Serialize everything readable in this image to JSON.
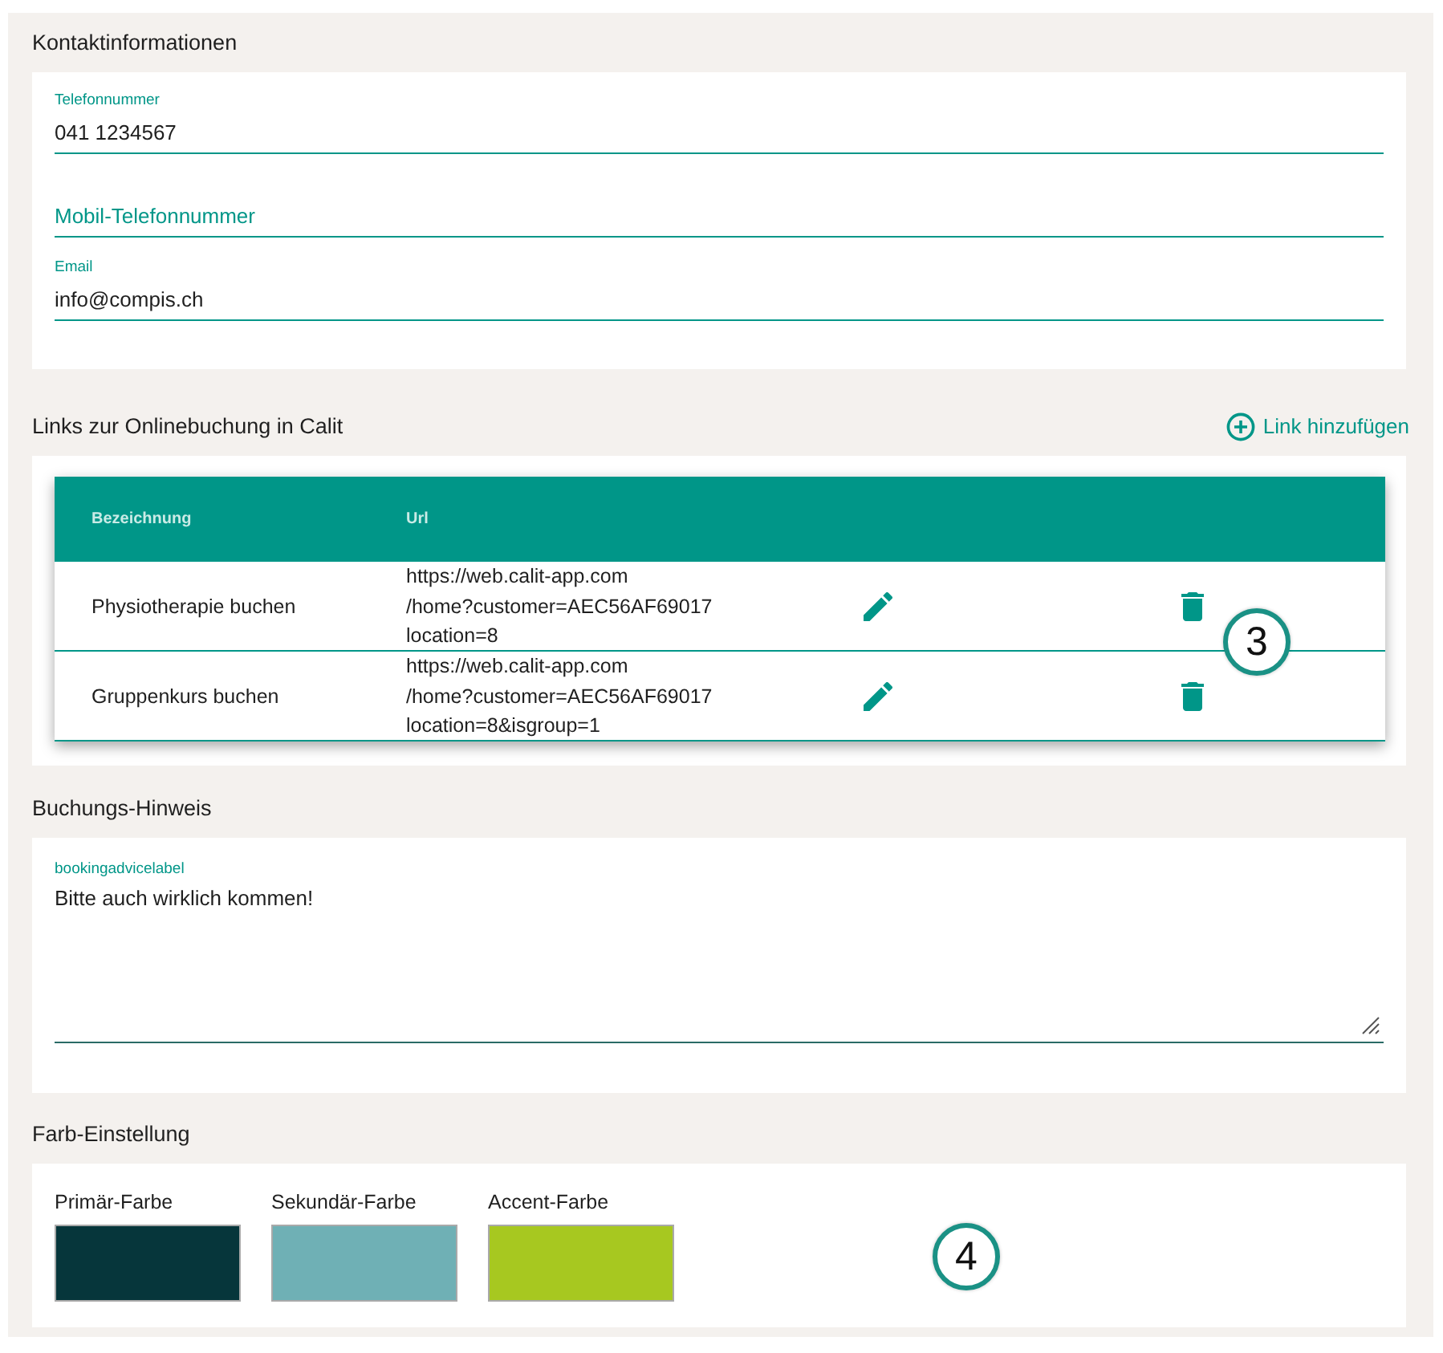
{
  "contact": {
    "title": "Kontaktinformationen",
    "fields": [
      {
        "label": "Telefonnummer",
        "value": "041 1234567"
      },
      {
        "placeholder": "Mobil-Telefonnummer"
      },
      {
        "label": "Email",
        "value": "info@compis.ch"
      }
    ]
  },
  "links": {
    "title": "Links zur Onlinebuchung in Calit",
    "add_button": "Link hinzufügen",
    "table": {
      "columns": [
        "Bezeichnung",
        "Url"
      ],
      "rows": [
        {
          "name": "Physiotherapie buchen",
          "url": "https://web.calit-app.com\n/home?customer=AEC56AF69017\nlocation=8"
        },
        {
          "name": "Gruppenkurs buchen",
          "url": "https://web.calit-app.com\n/home?customer=AEC56AF69017\nlocation=8&isgroup=1"
        }
      ]
    },
    "marker": "3"
  },
  "booking_advice": {
    "title": "Buchungs-Hinweis",
    "field": {
      "label": "bookingadvicelabel",
      "value": "Bitte auch wirklich kommen!"
    }
  },
  "colors": {
    "title": "Farb-Einstellung",
    "swatches": [
      {
        "label": "Primär-Farbe",
        "color": "#06363b"
      },
      {
        "label": "Sekundär-Farbe",
        "color": "#6fb0b5"
      },
      {
        "label": "Accent-Farbe",
        "color": "#a7c820"
      }
    ],
    "marker": "4"
  }
}
